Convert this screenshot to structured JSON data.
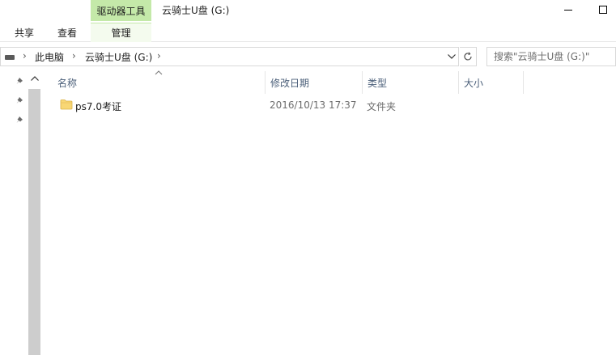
{
  "window": {
    "context_tab_group": "驱动器工具",
    "title": "云骑士U盘 (G:)"
  },
  "ribbon": {
    "tabs": [
      {
        "label": "共享"
      },
      {
        "label": "查看"
      },
      {
        "label": "管理"
      }
    ]
  },
  "address": {
    "crumbs": [
      "此电脑",
      "云骑士U盘 (G:)"
    ]
  },
  "search": {
    "placeholder": "搜索\"云骑士U盘 (G:)\""
  },
  "columns": {
    "name": "名称",
    "modified": "修改日期",
    "type": "类型",
    "size": "大小"
  },
  "files": [
    {
      "name": "ps7.0考证",
      "modified": "2016/10/13 17:37",
      "type": "文件夹",
      "size": ""
    }
  ],
  "icons": {
    "drive": "drive-icon",
    "pin": "pin-icon",
    "folder": "folder-icon",
    "refresh": "refresh-icon"
  },
  "colors": {
    "context_tab": "#c4e9a9",
    "header_text": "#4c607a",
    "secondary_text": "#6d6d6d",
    "folder_fill": "#f8d775"
  }
}
